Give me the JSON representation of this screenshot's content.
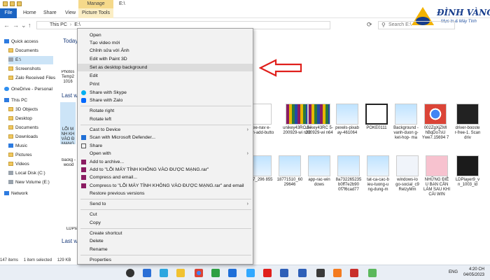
{
  "window": {
    "title_path": "E:\\",
    "manage_label": "Manage",
    "tabs": [
      "File",
      "Home",
      "Share",
      "View",
      "Picture Tools"
    ]
  },
  "logo": {
    "name": "ĐÌNH VÀNG",
    "tagline": "Mực In & Máy Tính"
  },
  "address": {
    "crumbs": [
      "This PC",
      "E:\\"
    ],
    "search_placeholder": "Search E:\\"
  },
  "sidebar": {
    "items": [
      {
        "label": "Quick access",
        "icon": "star-icon"
      },
      {
        "label": "Documents",
        "icon": "folder-icon"
      },
      {
        "label": "E:\\",
        "icon": "drive-icon"
      },
      {
        "label": "Screenshots",
        "icon": "folder-icon"
      },
      {
        "label": "Zalo Received Files",
        "icon": "folder-icon"
      },
      {
        "label": "OneDrive - Personal",
        "icon": "cloud-icon"
      },
      {
        "label": "This PC",
        "icon": "computer-icon"
      },
      {
        "label": "3D Objects",
        "icon": "folder-icon"
      },
      {
        "label": "Desktop",
        "icon": "folder-icon"
      },
      {
        "label": "Documents",
        "icon": "folder-icon"
      },
      {
        "label": "Downloads",
        "icon": "folder-icon"
      },
      {
        "label": "Music",
        "icon": "music-icon"
      },
      {
        "label": "Pictures",
        "icon": "folder-icon"
      },
      {
        "label": "Videos",
        "icon": "folder-icon"
      },
      {
        "label": "Local Disk (C:)",
        "icon": "drive-icon"
      },
      {
        "label": "New Volume (E:)",
        "icon": "drive-icon"
      },
      {
        "label": "Network",
        "icon": "network-icon"
      }
    ]
  },
  "files": {
    "group_today": "Today",
    "group_last_week": "Last w",
    "group_last_week2": "Last w",
    "group_last_week3": "Last w",
    "left_items": [
      "Photos Temp2 1016",
      "LỖI M NH KH VÀO Đ MẠNG",
      "backg -wood",
      "LDPla"
    ],
    "row1": [
      {
        "label": "free-nav e-icon-add-butto",
        "kind": "doc"
      },
      {
        "label": "unikey43RC 5-200929-wi n32",
        "kind": "rar"
      },
      {
        "label": "unikey43RC 5-200929-wi n64",
        "kind": "rar"
      },
      {
        "label": "pexels-pixab ay-461064",
        "kind": "img"
      },
      {
        "label": "POKE0111",
        "kind": "apk"
      },
      {
        "label": "Background -vanh-duon g-ket-hop- ma",
        "kind": "img"
      },
      {
        "label": "002ZgXjZMl hBqDo7sU Ywe7.15694 7",
        "kind": "chrome"
      },
      {
        "label": "driver-booste r-free-1. Scan driv",
        "kind": "dark"
      }
    ],
    "row2": [
      {
        "label": "187_296 855",
        "kind": "img"
      },
      {
        "label": "18771510_60 29646",
        "kind": "img"
      },
      {
        "label": "app-rac-win dows",
        "kind": "img"
      },
      {
        "label": "8a732265235 b0ff7e2b90 0f7f6cad77",
        "kind": "img"
      },
      {
        "label": "tat-ca-cac-b ieu-tuong-u ng-dung-m",
        "kind": "img"
      },
      {
        "label": "windows-lo go-social_c9 RelzyMm",
        "kind": "win"
      },
      {
        "label": "NHỮNG ĐIỀ U BẠN CẦN LÀM SAU KHI CÀI WIN",
        "kind": "pink"
      },
      {
        "label": "LDPlayer9_v n_1003_ld",
        "kind": "ldp"
      }
    ]
  },
  "status": {
    "count": "147 items",
    "selected": "1 item selected",
    "size": "129 KB"
  },
  "taskbar": {
    "lang": "ENG",
    "time": "4:20 CH",
    "date": "04/05/2023"
  },
  "context_menu": {
    "items": [
      {
        "label": "Open",
        "icon": "",
        "submenu": false
      },
      {
        "label": "Tạo video mới",
        "icon": "",
        "submenu": false
      },
      {
        "label": "Chỉnh sửa với Ảnh",
        "icon": "",
        "submenu": false
      },
      {
        "label": "Edit with Paint 3D",
        "icon": "",
        "submenu": false
      },
      {
        "label": "Set as desktop background",
        "icon": "",
        "submenu": false
      },
      {
        "label": "Edit",
        "icon": "",
        "submenu": false
      },
      {
        "label": "Print",
        "icon": "",
        "submenu": false
      },
      {
        "label": "Share with Skype",
        "icon": "skype-icon",
        "submenu": false
      },
      {
        "label": "Share with Zalo",
        "icon": "zalo-icon",
        "submenu": false
      },
      {
        "label": "Rotate right",
        "icon": "",
        "submenu": false
      },
      {
        "label": "Rotate left",
        "icon": "",
        "submenu": false
      },
      {
        "label": "Cast to Device",
        "icon": "",
        "submenu": true
      },
      {
        "label": "Scan with Microsoft Defender...",
        "icon": "defender-icon",
        "submenu": false
      },
      {
        "label": "Share",
        "icon": "share-icon",
        "submenu": false
      },
      {
        "label": "Open with",
        "icon": "",
        "submenu": true
      },
      {
        "label": "Add to archive...",
        "icon": "winrar-icon",
        "submenu": false
      },
      {
        "label": "Add to \"LỖI MÁY TÍNH KHÔNG VÀO ĐƯỢC MẠNG.rar\"",
        "icon": "winrar-icon",
        "submenu": false
      },
      {
        "label": "Compress and email...",
        "icon": "winrar-icon",
        "submenu": false
      },
      {
        "label": "Compress to \"LỖI MÁY TÍNH KHÔNG VÀO ĐƯỢC MẠNG.rar\" and email",
        "icon": "winrar-icon",
        "submenu": false
      },
      {
        "label": "Restore previous versions",
        "icon": "",
        "submenu": false
      },
      {
        "label": "Send to",
        "icon": "",
        "submenu": true
      },
      {
        "label": "Cut",
        "icon": "",
        "submenu": false
      },
      {
        "label": "Copy",
        "icon": "",
        "submenu": false
      },
      {
        "label": "Create shortcut",
        "icon": "",
        "submenu": false
      },
      {
        "label": "Delete",
        "icon": "",
        "submenu": false
      },
      {
        "label": "Rename",
        "icon": "",
        "submenu": false
      },
      {
        "label": "Properties",
        "icon": "",
        "submenu": false
      }
    ],
    "highlighted": "Set as desktop background"
  },
  "colors": {
    "accent": "#1a63c2",
    "manage_tab": "#f5d98a",
    "annotation_arrow": "#e0201c"
  }
}
